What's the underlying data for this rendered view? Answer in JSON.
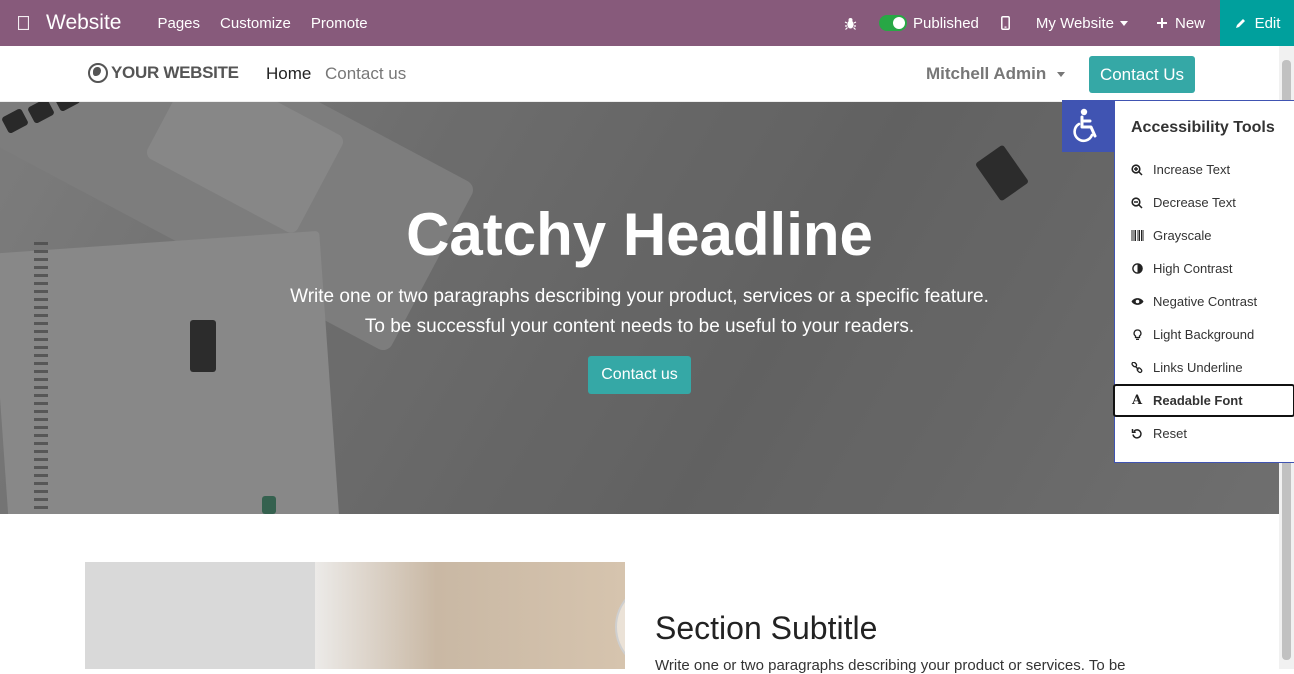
{
  "adminbar": {
    "brand": "Website",
    "menu": [
      "Pages",
      "Customize",
      "Promote"
    ],
    "published_label": "Published",
    "site_switcher": "My Website",
    "new_label": "New",
    "edit_label": "Edit",
    "accent": "#875a7b",
    "edit_color": "#00a09d"
  },
  "navbar": {
    "logo_text": "YOUR WEBSITE",
    "links": [
      "Home",
      "Contact us"
    ],
    "user": "Mitchell Admin",
    "cta": "Contact Us",
    "cta_color": "#35a8a6"
  },
  "hero": {
    "headline": "Catchy Headline",
    "line1": "Write one or two paragraphs describing your product, services or a specific feature.",
    "line2": "To be successful your content needs to be useful to your readers.",
    "button": "Contact us"
  },
  "section": {
    "subtitle": "Section Subtitle",
    "text": "Write one or two paragraphs describing your product or services. To be"
  },
  "accessibility": {
    "title": "Accessibility Tools",
    "toggle_color": "#4054b2",
    "items": [
      {
        "label": "Increase Text",
        "icon": "zoom-in-icon"
      },
      {
        "label": "Decrease Text",
        "icon": "zoom-out-icon"
      },
      {
        "label": "Grayscale",
        "icon": "barcode-icon"
      },
      {
        "label": "High Contrast",
        "icon": "contrast-icon"
      },
      {
        "label": "Negative Contrast",
        "icon": "eye-icon"
      },
      {
        "label": "Light Background",
        "icon": "lightbulb-icon"
      },
      {
        "label": "Links Underline",
        "icon": "link-icon"
      },
      {
        "label": "Readable Font",
        "icon": "font-icon"
      },
      {
        "label": "Reset",
        "icon": "reset-icon"
      }
    ]
  }
}
